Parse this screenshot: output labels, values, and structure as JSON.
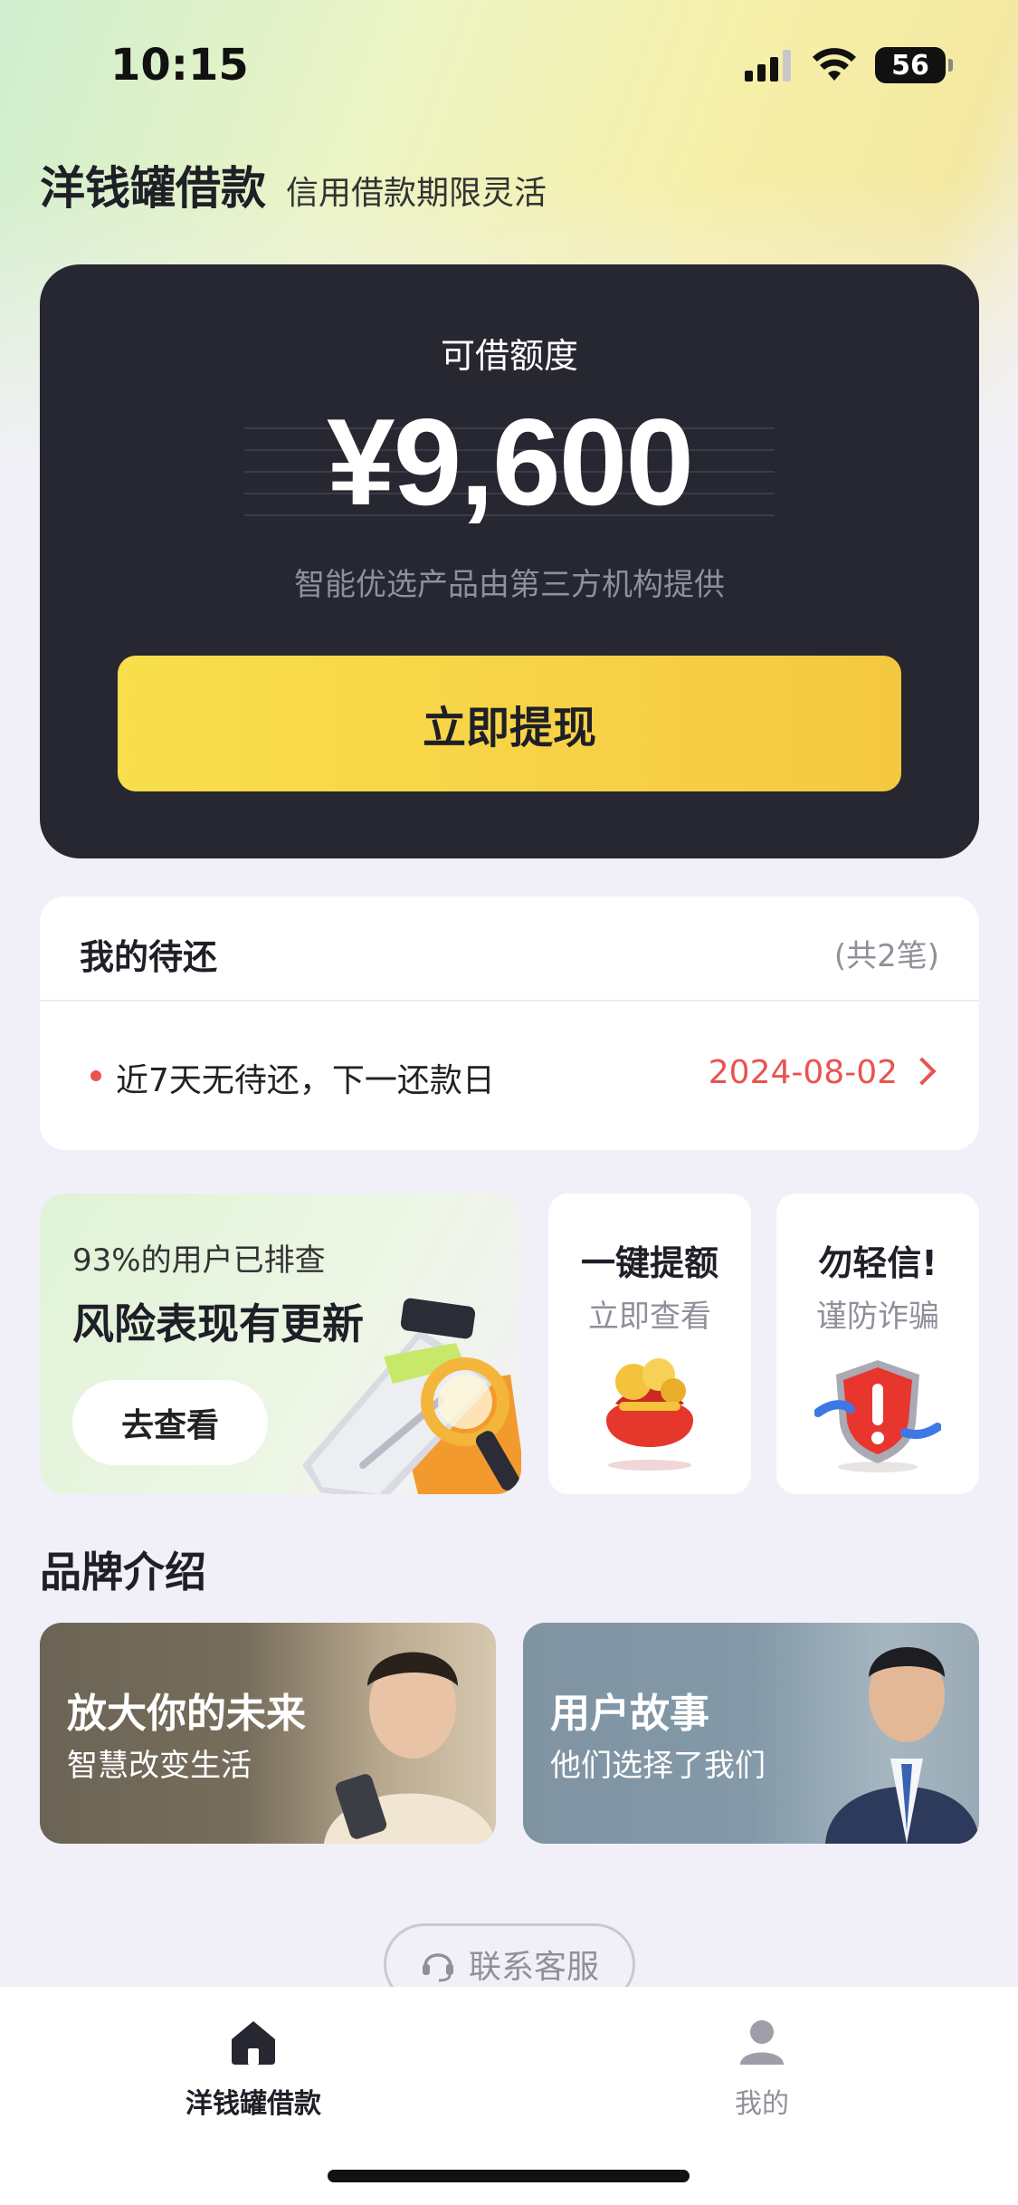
{
  "status_bar": {
    "time": "10:15",
    "battery": "56"
  },
  "header": {
    "title": "洋钱罐借款",
    "subtitle": "信用借款期限灵活"
  },
  "credit": {
    "label": "可借额度",
    "amount": "¥9,600",
    "note": "智能优选产品由第三方机构提供",
    "button": "立即提现"
  },
  "repayment": {
    "title": "我的待还",
    "count": "(共2笔)",
    "status_text": "近7天无待还，下一还款日",
    "next_date": "2024-08-02"
  },
  "risk_card": {
    "subtitle": "93%的用户已排查",
    "title": "风险表现有更新",
    "button": "去查看"
  },
  "mini_cards": [
    {
      "title": "一键提额",
      "subtitle": "立即查看",
      "icon": "money-bag-icon"
    },
    {
      "title": "勿轻信!",
      "subtitle": "谨防诈骗",
      "icon": "shield-warning-icon"
    }
  ],
  "brand": {
    "heading": "品牌介绍",
    "cards": [
      {
        "title": "放大你的未来",
        "subtitle": "智慧改变生活"
      },
      {
        "title": "用户故事",
        "subtitle": "他们选择了我们"
      }
    ]
  },
  "support": {
    "label": "联系客服"
  },
  "tab_bar": {
    "items": [
      {
        "label": "洋钱罐借款",
        "icon": "home-icon",
        "active": true
      },
      {
        "label": "我的",
        "icon": "user-icon",
        "active": false
      }
    ]
  },
  "colors": {
    "accent_yellow": "#f7d447",
    "dark_card": "#262731",
    "alert_red": "#e95350",
    "muted": "#8f909a"
  }
}
